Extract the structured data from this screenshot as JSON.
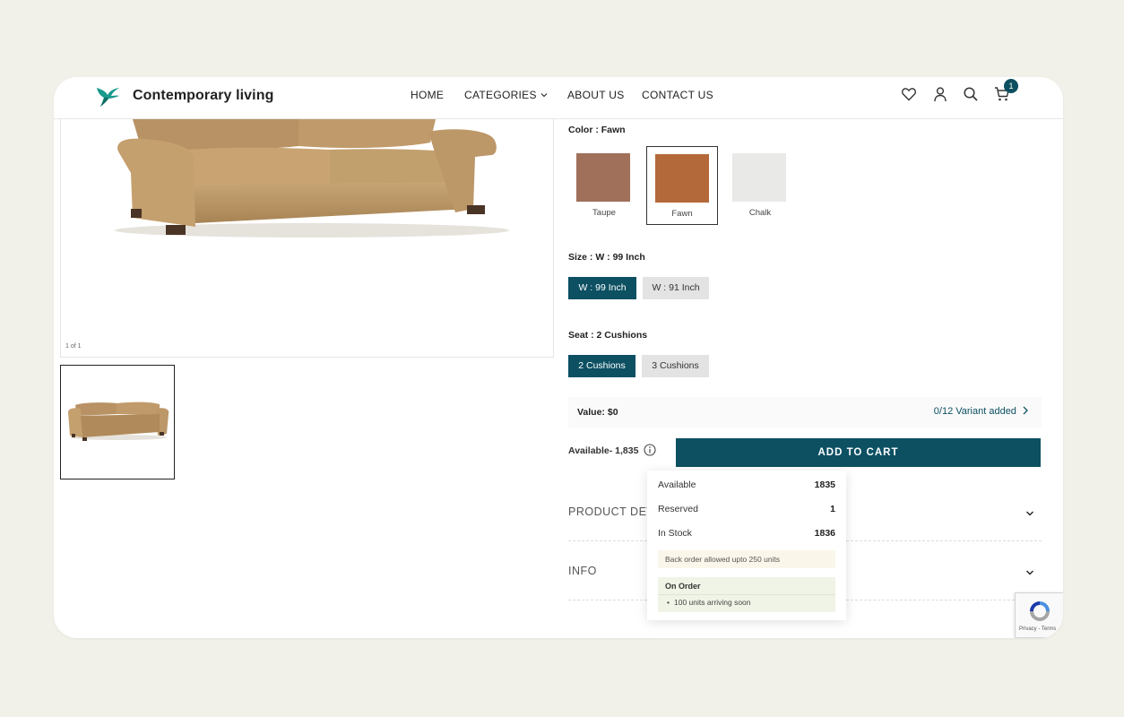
{
  "header": {
    "brand": "Contemporary living",
    "nav": [
      {
        "label": "HOME"
      },
      {
        "label": "CATEGORIES"
      },
      {
        "label": "ABOUT US"
      },
      {
        "label": "CONTACT US"
      }
    ],
    "cart_count": "1",
    "icons": [
      "heart-icon",
      "user-icon",
      "search-icon",
      "cart-icon"
    ]
  },
  "gallery": {
    "counter": "1 of 1"
  },
  "color": {
    "label": "Color : Fawn",
    "swatches": [
      {
        "name": "Taupe",
        "color": "#a0705a"
      },
      {
        "name": "Fawn",
        "color": "#b4693a"
      },
      {
        "name": "Chalk",
        "color": "#e9e9e7"
      }
    ]
  },
  "size": {
    "label": "Size : W : 99 Inch",
    "options": [
      "W : 99 Inch",
      "W : 91 Inch"
    ]
  },
  "seat": {
    "label": "Seat : 2 Cushions",
    "options": [
      "2 Cushions",
      "3 Cushions"
    ]
  },
  "value": {
    "label": "Value: $0",
    "variant_link": "0/12 Variant added"
  },
  "availability": {
    "label": "Available- 1,835"
  },
  "add_to_cart": "ADD TO CART",
  "accordions": [
    {
      "title": "PRODUCT DETAILS"
    },
    {
      "title": "INFO"
    }
  ],
  "popover": {
    "rows": [
      {
        "label": "Available",
        "value": "1835"
      },
      {
        "label": "Reserved",
        "value": "1"
      },
      {
        "label": "In Stock",
        "value": "1836"
      }
    ],
    "backorder": "Back order allowed upto 250 units",
    "on_order_title": "On Order",
    "on_order_item": "100 units arriving soon"
  },
  "recaptcha": {
    "text": "Privacy - Terms"
  },
  "colors": {
    "accent": "#0c5062",
    "background": "#f1f1ea"
  }
}
